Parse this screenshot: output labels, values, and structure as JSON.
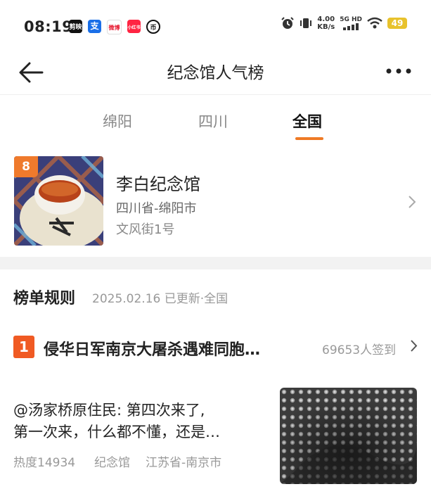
{
  "status_bar": {
    "time": "08:19",
    "app_icons": [
      "剪映",
      "支",
      "微博",
      "小红书",
      "币"
    ],
    "net_speed_value": "4.00",
    "net_speed_unit": "KB/s",
    "network": "5G HD",
    "battery": "49"
  },
  "nav": {
    "title": "纪念馆人气榜"
  },
  "tabs": [
    {
      "label": "绵阳"
    },
    {
      "label": "四川"
    },
    {
      "label": "全国"
    }
  ],
  "featured": {
    "rank": "8",
    "name": "李白纪念馆",
    "region": "四川省-绵阳市",
    "address": "文风街1号"
  },
  "rules": {
    "title": "榜单规则",
    "meta": "2025.02.16 已更新·全国"
  },
  "top_entry": {
    "rank": "1",
    "title": "侵华日军南京大屠杀遇难同胞…",
    "checkins": "69653人签到"
  },
  "review": {
    "line1": "@汤家桥原住民: 第四次来了,",
    "line2": "第一次来，什么都不懂，还是…",
    "heat": "热度14934",
    "category": "纪念馆",
    "location": "江苏省-南京市"
  },
  "colors": {
    "accent": "#ef7a25",
    "rank1": "#f05a23",
    "battery": "#e8c22c"
  }
}
